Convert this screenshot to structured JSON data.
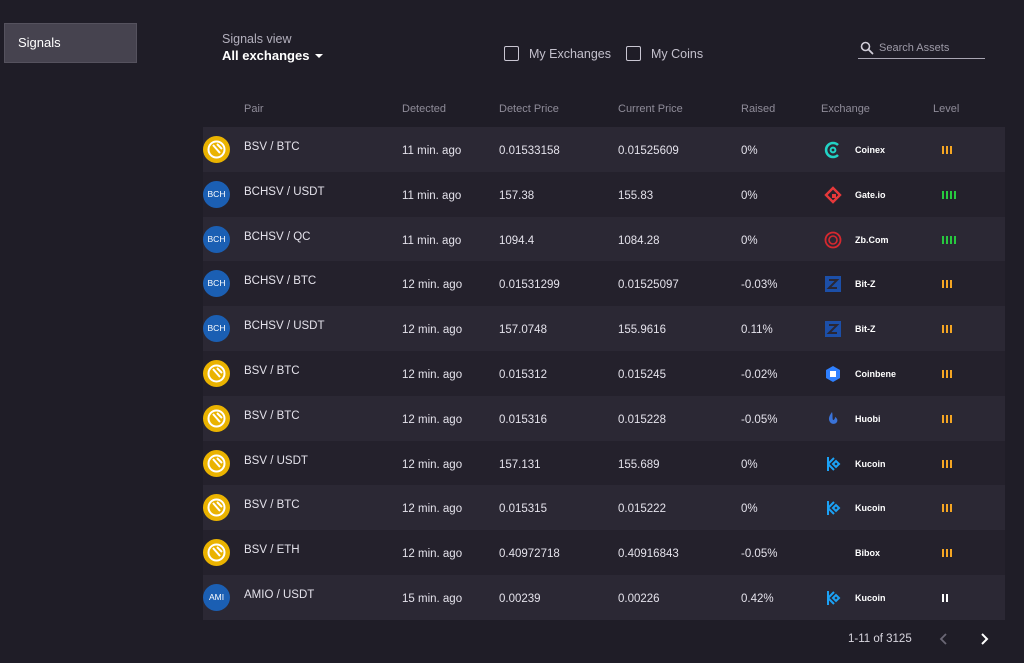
{
  "sidebar": {
    "items": [
      {
        "label": "Signals"
      }
    ]
  },
  "header": {
    "view_label": "Signals view",
    "view_value": "All exchanges",
    "filters": [
      {
        "label": "My Exchanges"
      },
      {
        "label": "My Coins"
      }
    ],
    "search_placeholder": "Search Assets"
  },
  "table": {
    "columns": [
      "Pair",
      "Detected",
      "Detect Price",
      "Current Price",
      "Raised",
      "Exchange",
      "Level"
    ],
    "rows": [
      {
        "coin_icon": "bsv-coin-icon",
        "badge": "",
        "pair": "BSV / BTC",
        "detected": "11 min. ago",
        "detect_price": "0.01533158",
        "current_price": "0.01525609",
        "raised": "0%",
        "exchange": "Coinex",
        "exchange_icon": "coinex-logo-icon",
        "level": 3,
        "level_color": "#f5a623"
      },
      {
        "coin_icon": "bch-coin-icon",
        "badge": "BCH",
        "pair": "BCHSV / USDT",
        "detected": "11 min. ago",
        "detect_price": "157.38",
        "current_price": "155.83",
        "raised": "0%",
        "exchange": "Gate.io",
        "exchange_icon": "gateio-logo-icon",
        "level": 4,
        "level_color": "#27c93f"
      },
      {
        "coin_icon": "bch-coin-icon",
        "badge": "BCH",
        "pair": "BCHSV / QC",
        "detected": "11 min. ago",
        "detect_price": "1094.4",
        "current_price": "1084.28",
        "raised": "0%",
        "exchange": "Zb.Com",
        "exchange_icon": "zb-logo-icon",
        "level": 4,
        "level_color": "#27c93f"
      },
      {
        "coin_icon": "bch-coin-icon",
        "badge": "BCH",
        "pair": "BCHSV / BTC",
        "detected": "12 min. ago",
        "detect_price": "0.01531299",
        "current_price": "0.01525097",
        "raised": "-0.03%",
        "exchange": "Bit-Z",
        "exchange_icon": "bitz-logo-icon",
        "level": 3,
        "level_color": "#f5a623"
      },
      {
        "coin_icon": "bch-coin-icon",
        "badge": "BCH",
        "pair": "BCHSV / USDT",
        "detected": "12 min. ago",
        "detect_price": "157.0748",
        "current_price": "155.9616",
        "raised": "0.11%",
        "exchange": "Bit-Z",
        "exchange_icon": "bitz-logo-icon",
        "level": 3,
        "level_color": "#f5a623"
      },
      {
        "coin_icon": "bsv-coin-icon",
        "badge": "",
        "pair": "BSV / BTC",
        "detected": "12 min. ago",
        "detect_price": "0.015312",
        "current_price": "0.015245",
        "raised": "-0.02%",
        "exchange": "Coinbene",
        "exchange_icon": "coinbene-logo-icon",
        "level": 3,
        "level_color": "#f5a623"
      },
      {
        "coin_icon": "bsv-coin-icon",
        "badge": "",
        "pair": "BSV / BTC",
        "detected": "12 min. ago",
        "detect_price": "0.015316",
        "current_price": "0.015228",
        "raised": "-0.05%",
        "exchange": "Huobi",
        "exchange_icon": "huobi-logo-icon",
        "level": 3,
        "level_color": "#f5a623"
      },
      {
        "coin_icon": "bsv-coin-icon",
        "badge": "",
        "pair": "BSV / USDT",
        "detected": "12 min. ago",
        "detect_price": "157.131",
        "current_price": "155.689",
        "raised": "0%",
        "exchange": "Kucoin",
        "exchange_icon": "kucoin-logo-icon",
        "level": 3,
        "level_color": "#f5a623"
      },
      {
        "coin_icon": "bsv-coin-icon",
        "badge": "",
        "pair": "BSV / BTC",
        "detected": "12 min. ago",
        "detect_price": "0.015315",
        "current_price": "0.015222",
        "raised": "0%",
        "exchange": "Kucoin",
        "exchange_icon": "kucoin-logo-icon",
        "level": 3,
        "level_color": "#f5a623"
      },
      {
        "coin_icon": "bsv-coin-icon",
        "badge": "",
        "pair": "BSV / ETH",
        "detected": "12 min. ago",
        "detect_price": "0.40972718",
        "current_price": "0.40916843",
        "raised": "-0.05%",
        "exchange": "Bibox",
        "exchange_icon": "bibox-logo-icon",
        "level": 3,
        "level_color": "#f5a623"
      },
      {
        "coin_icon": "ami-coin-icon",
        "badge": "AMI",
        "pair": "AMIO / USDT",
        "detected": "15 min. ago",
        "detect_price": "0.00239",
        "current_price": "0.00226",
        "raised": "0.42%",
        "exchange": "Kucoin",
        "exchange_icon": "kucoin-logo-icon",
        "level": 2,
        "level_color": "#ffffff"
      }
    ]
  },
  "pagination": {
    "range": "1-11 of 3125"
  },
  "colors": {
    "background": "#1f1d27",
    "row_alt": "#2b2834",
    "level_orange": "#f5a623",
    "level_green": "#27c93f",
    "badge_blue": "#1b5fb3",
    "bsv_gold": "#eab300"
  }
}
